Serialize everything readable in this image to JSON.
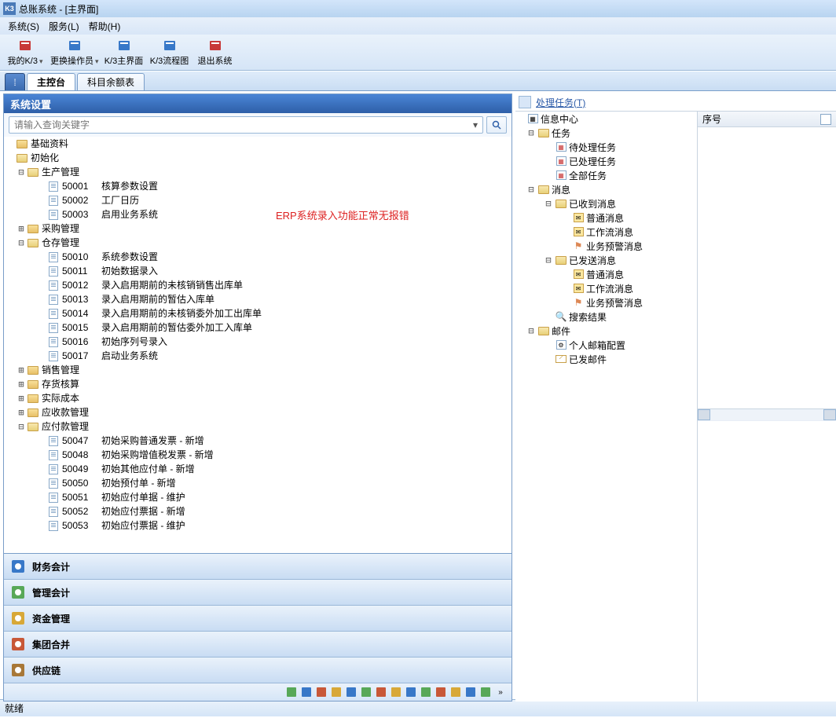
{
  "title": "总账系统 - [主界面]",
  "menus": [
    "系统(S)",
    "服务(L)",
    "帮助(H)"
  ],
  "toolbar": [
    {
      "id": "my-k3",
      "label": "我的K/3",
      "arrow": true,
      "color": "#c83838"
    },
    {
      "id": "switch-op",
      "label": "更换操作员",
      "arrow": true,
      "color": "#3878c8"
    },
    {
      "id": "k3-main",
      "label": "K/3主界面",
      "color": "#3878c8"
    },
    {
      "id": "k3-flow",
      "label": "K/3流程图",
      "color": "#3878c8"
    },
    {
      "id": "exit",
      "label": "退出系统",
      "color": "#c83838"
    }
  ],
  "maintabs": [
    {
      "id": "zhukongtai",
      "label": "主控台",
      "active": true
    },
    {
      "id": "kemuyue",
      "label": "科目余额表",
      "active": false
    }
  ],
  "panel": {
    "title": "系统设置",
    "search_placeholder": "请输入查询关键字",
    "erp_note": "ERP系统录入功能正常无报错"
  },
  "tree": [
    {
      "type": "folder",
      "label": "基础资料",
      "state": "",
      "level": 1
    },
    {
      "type": "folder",
      "label": "初始化",
      "state": "open",
      "level": 1
    },
    {
      "type": "folder",
      "label": "生产管理",
      "state": "minus",
      "level": 2,
      "children": [
        {
          "code": "50001",
          "label": "核算参数设置"
        },
        {
          "code": "50002",
          "label": "工厂日历"
        },
        {
          "code": "50003",
          "label": "启用业务系统"
        }
      ]
    },
    {
      "type": "folder",
      "label": "采购管理",
      "state": "plus",
      "level": 2
    },
    {
      "type": "folder",
      "label": "仓存管理",
      "state": "minus",
      "level": 2,
      "children": [
        {
          "code": "50010",
          "label": "系统参数设置"
        },
        {
          "code": "50011",
          "label": "初始数据录入"
        },
        {
          "code": "50012",
          "label": "录入启用期前的未核销销售出库单"
        },
        {
          "code": "50013",
          "label": "录入启用期前的暂估入库单"
        },
        {
          "code": "50014",
          "label": "录入启用期前的未核销委外加工出库单"
        },
        {
          "code": "50015",
          "label": "录入启用期前的暂估委外加工入库单"
        },
        {
          "code": "50016",
          "label": "初始序列号录入"
        },
        {
          "code": "50017",
          "label": "启动业务系统"
        }
      ]
    },
    {
      "type": "folder",
      "label": "销售管理",
      "state": "plus",
      "level": 2
    },
    {
      "type": "folder",
      "label": "存货核算",
      "state": "plus",
      "level": 2
    },
    {
      "type": "folder",
      "label": "实际成本",
      "state": "plus",
      "level": 2
    },
    {
      "type": "folder",
      "label": "应收款管理",
      "state": "plus",
      "level": 2
    },
    {
      "type": "folder",
      "label": "应付款管理",
      "state": "minus",
      "level": 2,
      "children": [
        {
          "code": "50047",
          "label": "初始采购普通发票 - 新增"
        },
        {
          "code": "50048",
          "label": "初始采购增值税发票 - 新增"
        },
        {
          "code": "50049",
          "label": "初始其他应付单 - 新增"
        },
        {
          "code": "50050",
          "label": "初始预付单 - 新增"
        },
        {
          "code": "50051",
          "label": "初始应付单据 - 维护"
        },
        {
          "code": "50052",
          "label": "初始应付票据 - 新增"
        },
        {
          "code": "50053",
          "label": "初始应付票据 - 维护"
        }
      ]
    }
  ],
  "navbuttons": [
    {
      "id": "caiwu",
      "label": "财务会计",
      "color": "#3878c8"
    },
    {
      "id": "guanli",
      "label": "管理会计",
      "color": "#58a858"
    },
    {
      "id": "zijin",
      "label": "资金管理",
      "color": "#d8a838"
    },
    {
      "id": "jituan",
      "label": "集团合并",
      "color": "#c85838"
    },
    {
      "id": "gongying",
      "label": "供应链",
      "color": "#a87838"
    }
  ],
  "task": {
    "link": "处理任务(T)",
    "grid_header": "序号",
    "tree": [
      {
        "label": "信息中心",
        "level": 1,
        "state": "",
        "icon": "box"
      },
      {
        "label": "任务",
        "level": 2,
        "state": "minus",
        "icon": "folder"
      },
      {
        "label": "待处理任务",
        "level": 3,
        "icon": "cal"
      },
      {
        "label": "已处理任务",
        "level": 3,
        "icon": "cal"
      },
      {
        "label": "全部任务",
        "level": 3,
        "icon": "cal"
      },
      {
        "label": "消息",
        "level": 2,
        "state": "minus",
        "icon": "folder"
      },
      {
        "label": "已收到消息",
        "level": 3,
        "state": "minus",
        "icon": "folder"
      },
      {
        "label": "普通消息",
        "level": 4,
        "icon": "msg"
      },
      {
        "label": "工作流消息",
        "level": 4,
        "icon": "msg"
      },
      {
        "label": "业务预警消息",
        "level": 4,
        "icon": "flag"
      },
      {
        "label": "已发送消息",
        "level": 3,
        "state": "minus",
        "icon": "folder"
      },
      {
        "label": "普通消息",
        "level": 4,
        "icon": "msg"
      },
      {
        "label": "工作流消息",
        "level": 4,
        "icon": "msg"
      },
      {
        "label": "业务预警消息",
        "level": 4,
        "icon": "flag"
      },
      {
        "label": "搜索结果",
        "level": 3,
        "icon": "search"
      },
      {
        "label": "邮件",
        "level": 2,
        "state": "minus",
        "icon": "folder"
      },
      {
        "label": "个人邮箱配置",
        "level": 3,
        "icon": "gear"
      },
      {
        "label": "已发邮件",
        "level": 3,
        "icon": "mail"
      }
    ]
  },
  "status": "就绪"
}
